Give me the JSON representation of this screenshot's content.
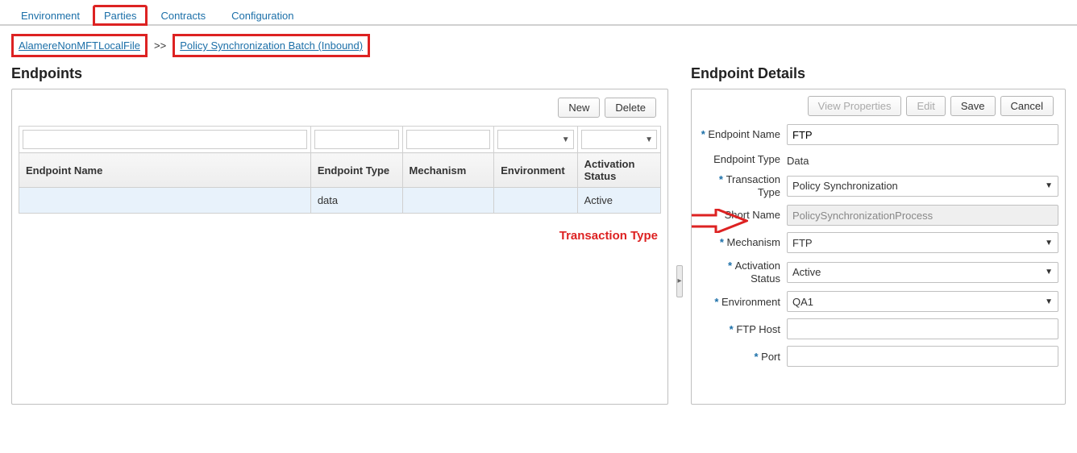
{
  "tabs": {
    "environment": "Environment",
    "parties": "Parties",
    "contracts": "Contracts",
    "configuration": "Configuration"
  },
  "breadcrumb": {
    "item1": "AlamereNonMFTLocalFile",
    "sep": ">>",
    "item2": "Policy Synchronization Batch (Inbound)"
  },
  "left": {
    "title": "Endpoints",
    "buttons": {
      "new": "New",
      "delete": "Delete"
    },
    "columns": {
      "name": "Endpoint Name",
      "type": "Endpoint Type",
      "mech": "Mechanism",
      "env": "Environment",
      "act": "Activation Status"
    },
    "row": {
      "name": "",
      "type": "data",
      "mech": "",
      "env": "",
      "act": "Active"
    },
    "annotation": "Transaction Type"
  },
  "right": {
    "title": "Endpoint Details",
    "buttons": {
      "view": "View Properties",
      "edit": "Edit",
      "save": "Save",
      "cancel": "Cancel"
    },
    "fields": {
      "endpoint_name": {
        "label": "Endpoint Name",
        "value": "FTP"
      },
      "endpoint_type": {
        "label": "Endpoint Type",
        "value": "Data"
      },
      "transaction_type": {
        "label": "Transaction Type",
        "value": "Policy Synchronization"
      },
      "short_name": {
        "label": "Short Name",
        "value": "PolicySynchronizationProcess"
      },
      "mechanism": {
        "label": "Mechanism",
        "value": "FTP"
      },
      "activation_status": {
        "label": "Activation Status",
        "value": "Active"
      },
      "environment": {
        "label": "Environment",
        "value": "QA1"
      },
      "ftp_host": {
        "label": "FTP Host",
        "value": ""
      },
      "port": {
        "label": "Port",
        "value": ""
      }
    }
  }
}
